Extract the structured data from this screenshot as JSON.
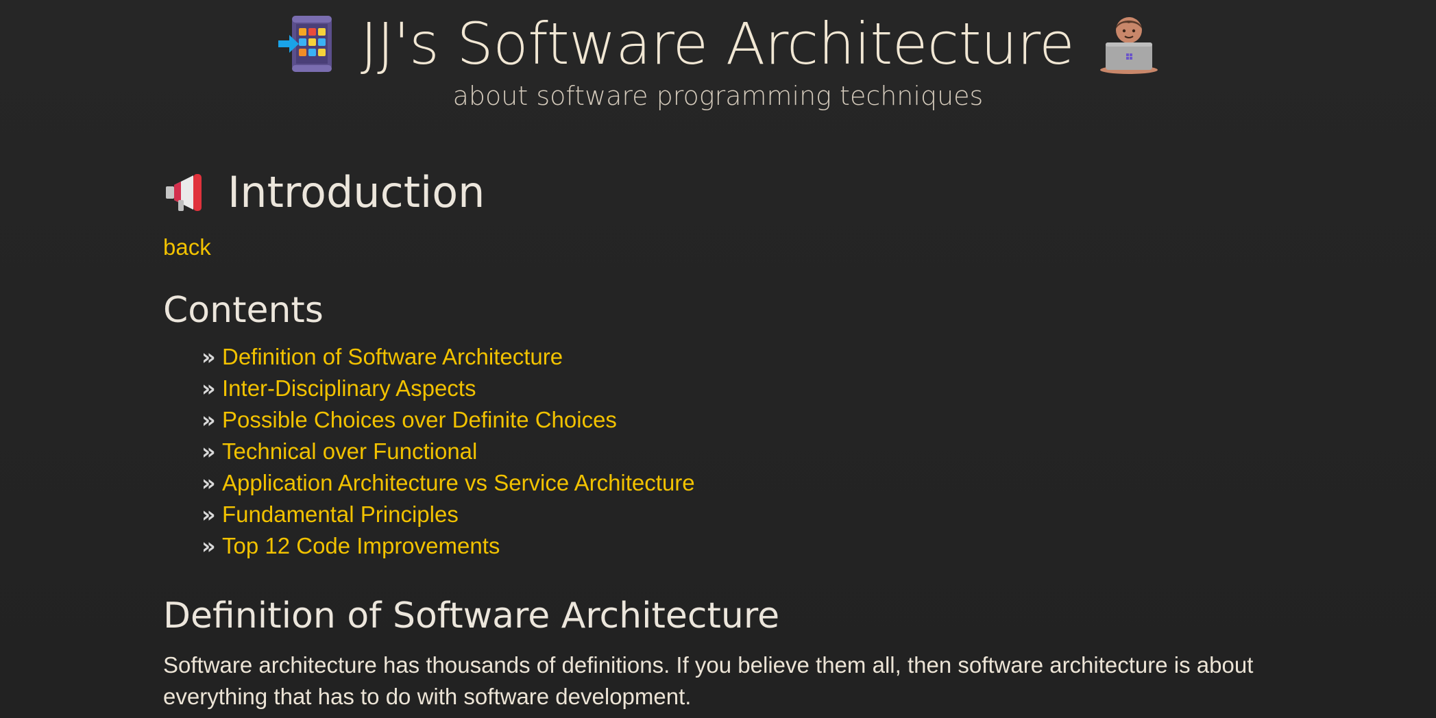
{
  "header": {
    "title": "JJ's Software Architecture",
    "tagline": "about software programming techniques",
    "left_icon": "app-grid-enter-icon",
    "right_icon": "technologist-laptop-icon"
  },
  "intro": {
    "heading": "Introduction",
    "heading_icon": "megaphone-icon",
    "back_label": "back"
  },
  "contents": {
    "heading": "Contents",
    "bullet": "»",
    "items": [
      {
        "label": "Definition of Software Architecture"
      },
      {
        "label": "Inter-Disciplinary Aspects"
      },
      {
        "label": "Possible Choices over Definite Choices"
      },
      {
        "label": "Technical over Functional"
      },
      {
        "label": "Application Architecture vs Service Architecture"
      },
      {
        "label": "Fundamental Principles"
      },
      {
        "label": "Top 12 Code Improvements"
      }
    ]
  },
  "definition": {
    "heading": "Definition of Software Architecture",
    "paragraph": "Software architecture has thousands of definitions. If you believe them all, then software architecture is about everything that has to do with software development."
  },
  "colors": {
    "background": "#242424",
    "text": "#ece4d6",
    "link": "#f2c200"
  }
}
